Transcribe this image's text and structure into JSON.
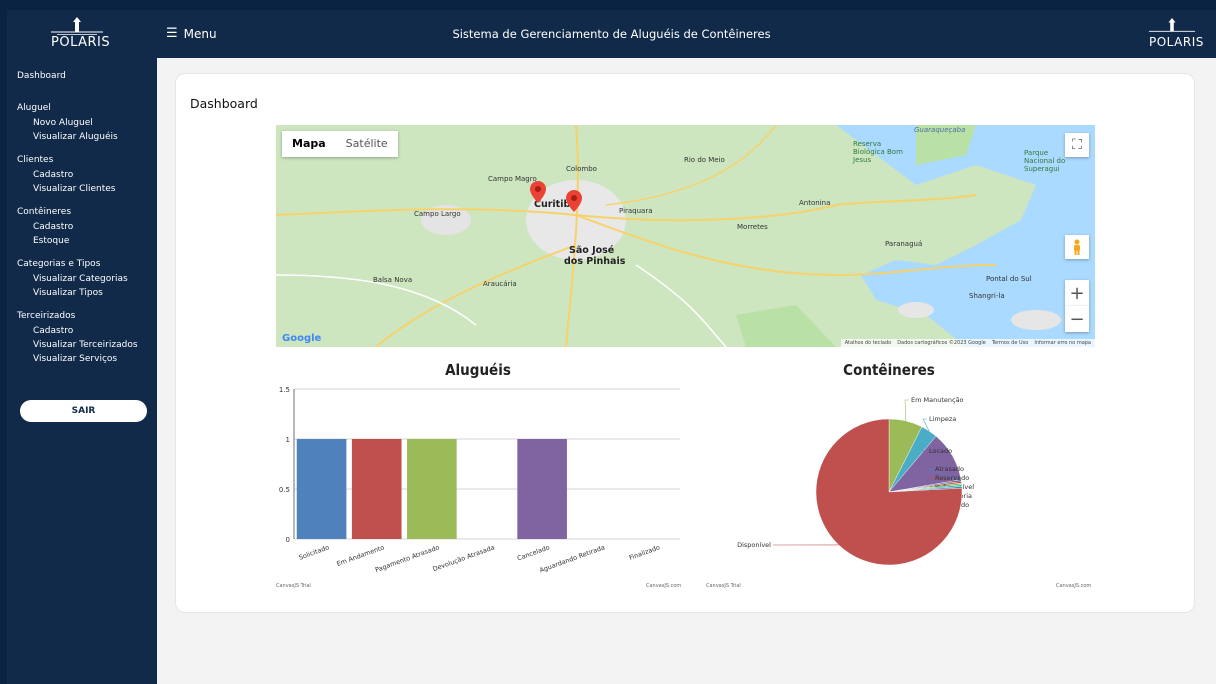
{
  "brand": {
    "name": "POLARIS"
  },
  "header": {
    "menu_label": "Menu",
    "title": "Sistema de Gerenciamento de Aluguéis de Contêineres"
  },
  "sidebar": {
    "dashboard": "Dashboard",
    "groups": [
      {
        "label": "Aluguel",
        "items": [
          "Novo Aluguel",
          "Visualizar Aluguéis"
        ]
      },
      {
        "label": "Clientes",
        "items": [
          "Cadastro",
          "Visualizar Clientes"
        ]
      },
      {
        "label": "Contêineres",
        "items": [
          "Cadastro",
          "Estoque"
        ]
      },
      {
        "label": "Categorias e Tipos",
        "items": [
          "Visualizar Categorias",
          "Visualizar Tipos"
        ]
      },
      {
        "label": "Terceirizados",
        "items": [
          "Cadastro",
          "Visualizar Terceirizados",
          "Visualizar Serviços"
        ]
      }
    ],
    "logout": "SAIR"
  },
  "main": {
    "title": "Dashboard"
  },
  "map": {
    "type_map": "Mapa",
    "type_satellite": "Satélite",
    "brand": "Google",
    "attribution": [
      "Atalhos do teclado",
      "Dados cartográficos ©2023 Google",
      "Termos de Uso",
      "Informar erro no mapa"
    ],
    "labels": {
      "curitiba": "Curitiba",
      "sao_jose": "São José",
      "dos_pinhais": "dos Pinhais",
      "colombo": "Colombo",
      "piraquara": "Piraquara",
      "rio_do_meio": "Rio do Meio",
      "campo_magro": "Campo Magro",
      "campo_largo": "Campo Largo",
      "araucaria": "Araucária",
      "balsa_nova": "Balsa Nova",
      "paranagua": "Paranaguá",
      "antonina": "Antonina",
      "morretes": "Morretes",
      "guaratuba": "Pontal do Sul",
      "matinhos": "Shangri-la",
      "reserva": "Reserva Biológica Bom Jesus",
      "guaraquecaba": "Guaraqueçaba",
      "superagui": "Parque Nacional do Superagui"
    }
  },
  "chart_data": [
    {
      "type": "bar",
      "title": "Aluguéis",
      "categories": [
        "Solicitado",
        "Em Andamento",
        "Pagamento Atrasado",
        "Devolução Atrasada",
        "Cancelado",
        "Aguardando Retirada",
        "Finalizado"
      ],
      "values": [
        1,
        1,
        1,
        0,
        1,
        0,
        0
      ],
      "colors": [
        "#4f81bc",
        "#c0504e",
        "#9bbb58",
        "#23bfaa",
        "#8064a1",
        "#4aacc5",
        "#f79647"
      ],
      "ylim": [
        0,
        1.5
      ],
      "yticks": [
        "0",
        "0.5",
        "1",
        "1.5"
      ],
      "credit_left": "CanvasJS Trial",
      "credit_right": "CanvasJS.com"
    },
    {
      "type": "pie",
      "title": "Contêineres",
      "labels": [
        "Em Manutenção",
        "Limpeza",
        "Locado",
        "Atrasado",
        "Reservado",
        "Indisponível",
        "Em Vistoria",
        "Cancelado",
        "Disponível"
      ],
      "values": [
        1,
        0.5,
        1.5,
        0.05,
        0.05,
        0.05,
        0.05,
        0.05,
        10.2
      ],
      "colors": [
        "#9bbb58",
        "#4aacc5",
        "#8064a1",
        "#4f81bc",
        "#c0504e",
        "#9bbb58",
        "#23bfaa",
        "#4f81bc",
        "#c0504e"
      ],
      "credit_left": "CanvasJS Trial",
      "credit_right": "CanvasJS.com"
    }
  ]
}
